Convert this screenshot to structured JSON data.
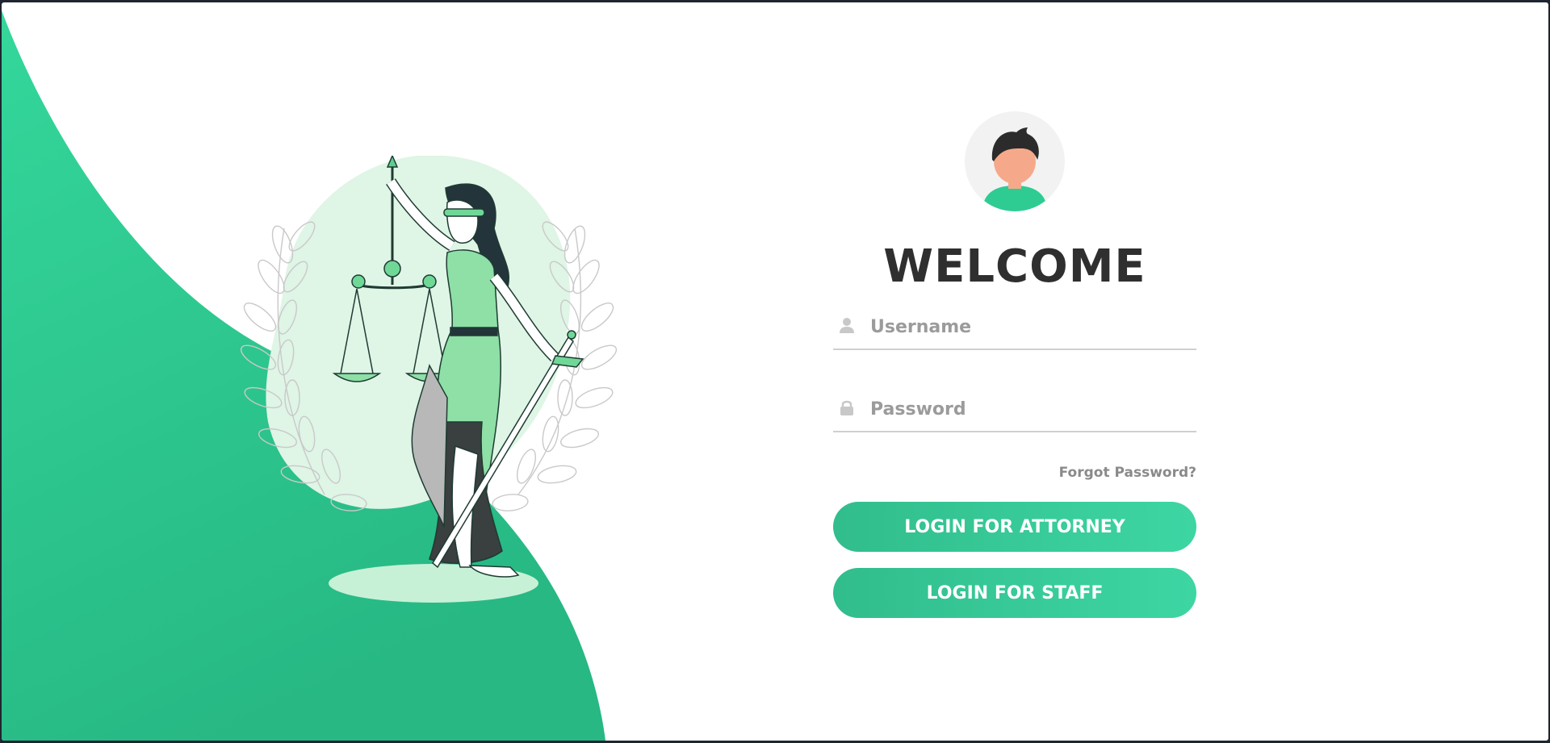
{
  "colors": {
    "accent": "#2ecc93",
    "accent_dark": "#25a878",
    "title": "#2f2f2f",
    "placeholder": "#9b9b9b"
  },
  "illustration": {
    "name": "lady-justice-illustration"
  },
  "login": {
    "avatar_icon": "user-avatar-icon",
    "title": "WELCOME",
    "username": {
      "icon": "user-icon",
      "placeholder": "Username",
      "value": ""
    },
    "password": {
      "icon": "lock-icon",
      "placeholder": "Password",
      "value": ""
    },
    "forgot_label": "Forgot Password?",
    "attorney_button": "LOGIN FOR ATTORNEY",
    "staff_button": "LOGIN FOR STAFF"
  }
}
